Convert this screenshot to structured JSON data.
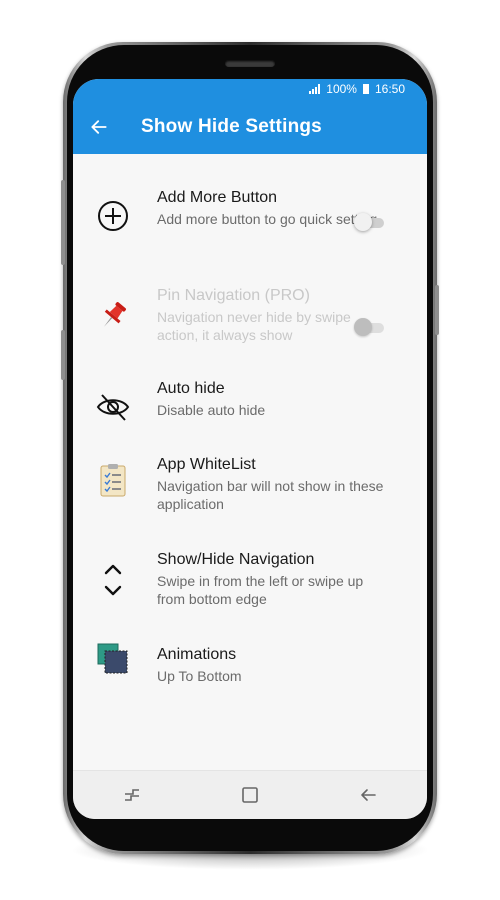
{
  "status_bar": {
    "battery": "100%",
    "time": "16:50"
  },
  "app_bar": {
    "title": "Show Hide Settings"
  },
  "settings": [
    {
      "title": "Add More Button",
      "subtitle": "Add more button to go quick setting",
      "icon": "add-circle-icon",
      "toggle": "off",
      "enabled": true
    },
    {
      "title": "Pin Navigation (PRO)",
      "subtitle": "Navigation never hide by swipe action, it always show",
      "icon": "pushpin-icon",
      "toggle": "off",
      "enabled": false
    },
    {
      "title": "Auto hide",
      "subtitle": "Disable auto hide",
      "icon": "eye-off-icon"
    },
    {
      "title": "App WhiteList",
      "subtitle": "Navigation bar will not show in these application",
      "icon": "clipboard-checklist-icon"
    },
    {
      "title": "Show/Hide Navigation",
      "subtitle": "Swipe in from the left or swipe up from bottom edge",
      "icon": "chevron-up-down-icon"
    },
    {
      "title": "Animations",
      "subtitle": "Up To Bottom",
      "icon": "overlapping-squares-icon"
    }
  ],
  "nav_bar": {
    "icons": [
      "recents-icon",
      "home-icon",
      "back-icon"
    ]
  },
  "colors": {
    "accent": "#1f8fe0",
    "background": "#f7f7f7",
    "nav_bar": "#efefef",
    "pin_red": "#d9251d",
    "animation_teal": "#2e9a86",
    "animation_navy": "#3b4a6b"
  }
}
